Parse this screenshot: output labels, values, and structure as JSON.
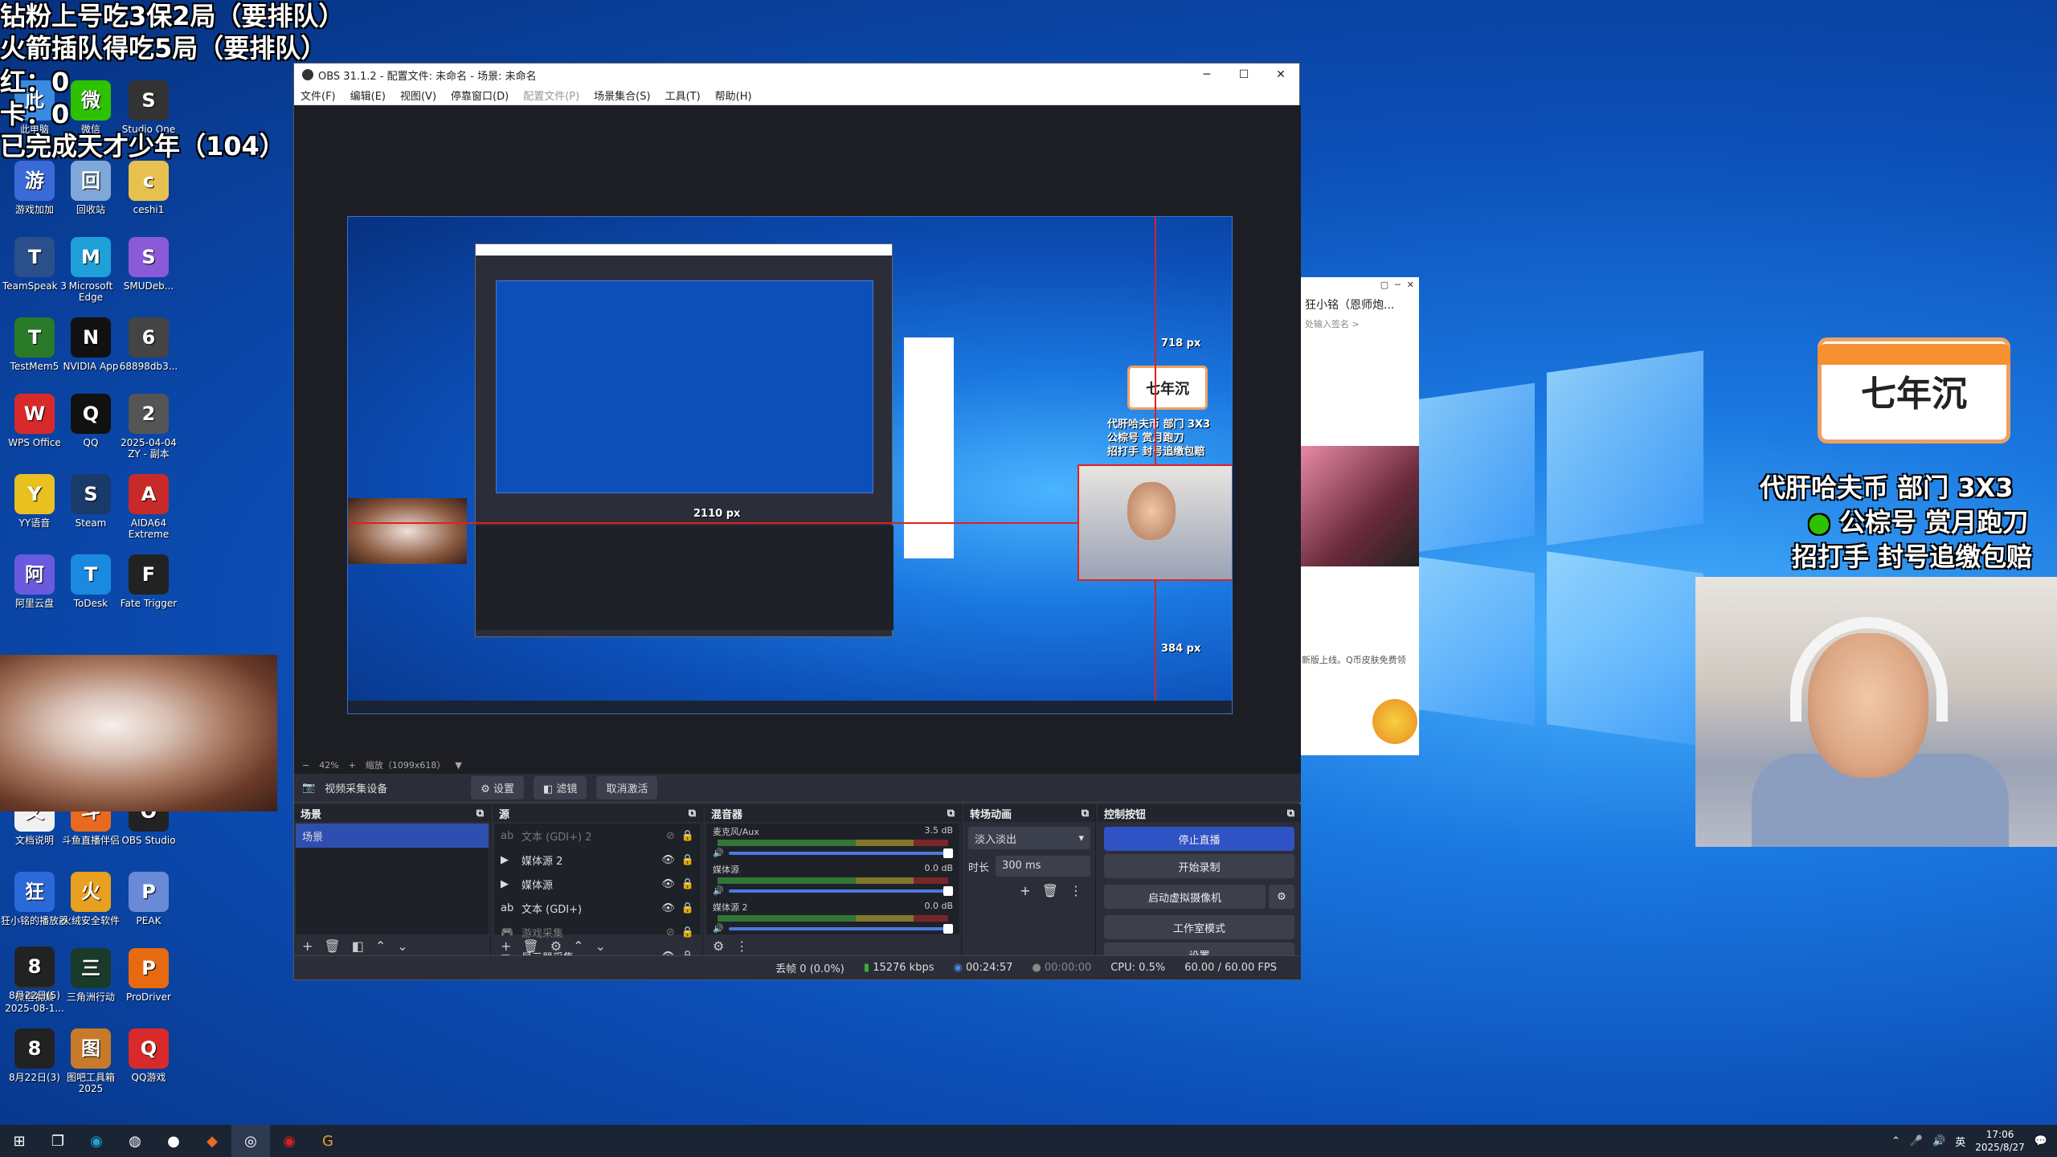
{
  "overlay": {
    "lines": [
      "钻粉上号吃3保2局（要排队）",
      "火箭插队得吃5局（要排队）",
      "红：0",
      "卡：0",
      "已完成天才少年（104）"
    ]
  },
  "desktop_icons": [
    {
      "label": "此电脑",
      "icon": "computer-icon",
      "color": "#3a8ae0"
    },
    {
      "label": "微信",
      "icon": "wechat-icon",
      "color": "#2dc100"
    },
    {
      "label": "Studio One",
      "icon": "studio-one-icon",
      "color": "#333"
    },
    {
      "label": "游戏加加",
      "icon": "gameplus-icon",
      "color": "#3a6ad8"
    },
    {
      "label": "回收站",
      "icon": "recycle-bin-icon",
      "color": "#7fa8d8"
    },
    {
      "label": "ceshi1",
      "icon": "folder-icon",
      "color": "#e8c050"
    },
    {
      "label": "TeamSpeak 3",
      "icon": "teamspeak-icon",
      "color": "#2a4f8a"
    },
    {
      "label": "Microsoft Edge",
      "icon": "edge-icon",
      "color": "#1ea0d8"
    },
    {
      "label": "SMUDeb...",
      "icon": "smu-icon",
      "color": "#8a5ad8"
    },
    {
      "label": "TestMem5",
      "icon": "testmem-icon",
      "color": "#2a7a2a"
    },
    {
      "label": "NVIDIA App",
      "icon": "nvidia-icon",
      "color": "#111"
    },
    {
      "label": "68898db3...",
      "icon": "image-icon",
      "color": "#444"
    },
    {
      "label": "WPS Office",
      "icon": "wps-icon",
      "color": "#d82a2a"
    },
    {
      "label": "QQ",
      "icon": "qq-icon",
      "color": "#111"
    },
    {
      "label": "2025-04-04 ZY - 副本",
      "icon": "shortcut-icon",
      "color": "#555"
    },
    {
      "label": "YY语音",
      "icon": "yy-icon",
      "color": "#e8c020"
    },
    {
      "label": "Steam",
      "icon": "steam-icon",
      "color": "#1a3a6a"
    },
    {
      "label": "AIDA64 Extreme",
      "icon": "aida64-icon",
      "color": "#c82a2a"
    },
    {
      "label": "阿里云盘",
      "icon": "aliyun-icon",
      "color": "#6a5ae0"
    },
    {
      "label": "ToDesk",
      "icon": "todesk-icon",
      "color": "#1a8ae0"
    },
    {
      "label": "Fate Trigger",
      "icon": "fate-trigger-icon",
      "color": "#222"
    },
    {
      "label": "文档说明",
      "icon": "text-file-icon",
      "color": "#f0f0f0"
    },
    {
      "label": "斗鱼直播伴侣",
      "icon": "douyu-icon",
      "color": "#e86a20"
    },
    {
      "label": "OBS Studio",
      "icon": "obs-icon",
      "color": "#222"
    },
    {
      "label": "狂小铭的播放器",
      "icon": "player-icon",
      "color": "#2a6ad8"
    },
    {
      "label": "火绒安全软件",
      "icon": "huorong-icon",
      "color": "#e8a020"
    },
    {
      "label": "PEAK",
      "icon": "peak-icon",
      "color": "#6a8ad8"
    },
    {
      "label": "微信视频 2025-08-1...",
      "icon": "video-icon",
      "color": "#333"
    },
    {
      "label": "三角洲行动",
      "icon": "delta-force-icon",
      "color": "#1a3a2a"
    },
    {
      "label": "ProDriver",
      "icon": "icon-brand-icon",
      "color": "#e86a10"
    },
    {
      "label": "8月22日(3)",
      "icon": "phone-file-icon",
      "color": "#222"
    },
    {
      "label": "图吧工具箱 2025",
      "icon": "toolbox-icon",
      "color": "#c87a2a"
    },
    {
      "label": "QQ游戏",
      "icon": "qqgame-icon",
      "color": "#d82a2a"
    },
    {
      "label": "8月22日(5)",
      "icon": "phone-file-icon",
      "color": "#222"
    }
  ],
  "obs": {
    "title": "OBS 31.1.2 - 配置文件: 未命名 - 场景: 未命名",
    "menu": [
      "文件(F)",
      "编辑(E)",
      "视图(V)",
      "停靠窗口(D)",
      "配置文件(P)",
      "场景集合(S)",
      "工具(T)",
      "帮助(H)"
    ],
    "preview_labels": {
      "top": "718 px",
      "left": "2110 px",
      "bottom": "384 px"
    },
    "zoom": "42%",
    "zoom_fit": "缩放（1099x618）",
    "source_bar": {
      "selected": "视频采集设备",
      "settings": "设置",
      "filters": "滤镜",
      "deactivate": "取消激活"
    },
    "scenes": {
      "title": "场景",
      "items": [
        "场景"
      ]
    },
    "sources": {
      "title": "源",
      "items": [
        {
          "name": "文本 (GDI+) 2",
          "type": "text-icon",
          "visible": false
        },
        {
          "name": "媒体源 2",
          "type": "play-icon",
          "visible": true
        },
        {
          "name": "媒体源",
          "type": "play-icon",
          "visible": true
        },
        {
          "name": "文本 (GDI+)",
          "type": "text-icon",
          "visible": true
        },
        {
          "name": "游戏采集",
          "type": "gamepad-icon",
          "visible": false
        },
        {
          "name": "显示器采集",
          "type": "monitor-icon",
          "visible": true
        }
      ]
    },
    "mixer": {
      "title": "混音器",
      "channels": [
        {
          "name": "麦克风/Aux",
          "db": "3.5 dB"
        },
        {
          "name": "媒体源",
          "db": "0.0 dB"
        },
        {
          "name": "媒体源 2",
          "db": "0.0 dB"
        }
      ],
      "scale": "-60 -55 -50 -45 -40 -35 -30 -25 -20 -15 -10 -5 0"
    },
    "transitions": {
      "title": "转场动画",
      "selected": "淡入淡出",
      "duration_label": "时长",
      "duration": "300 ms"
    },
    "controls": {
      "title": "控制按钮",
      "buttons": [
        "停止直播",
        "开始录制",
        "启动虚拟摄像机",
        "工作室模式",
        "设置"
      ]
    },
    "status": {
      "dropped": "丢帧 0 (0.0%)",
      "bitrate": "15276 kbps",
      "live_time": "00:24:57",
      "rec_time": "00:00:00",
      "cpu": "CPU: 0.5%",
      "fps": "60.00 / 60.00 FPS"
    }
  },
  "chat": {
    "title": "狂小铭（恩师炮...",
    "placeholder": "处输入签名 >",
    "notice": "新版上线。Q币皮肤免费领"
  },
  "overlay_right": {
    "badge": "七年沉",
    "promo": [
      "代肝哈夫币 部门 3X3",
      "公棕号 赏月跑刀",
      "招打手 封号追缴包赔"
    ]
  },
  "taskbar": {
    "time": "17:06",
    "date": "2025/8/27",
    "ime": "英"
  }
}
